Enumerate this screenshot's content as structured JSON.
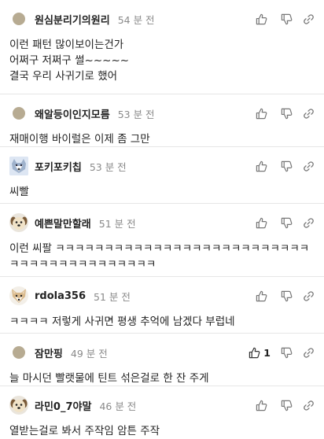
{
  "comments": [
    {
      "nickname": "원심분리기의원리",
      "time": "54 분 전",
      "text": "이런 패턴 많이보이는건가\n어쩌구 저쩌구 썰~~~~~\n결국 우리 사귀기로 했어",
      "avatar": "dot-avatar",
      "likes": ""
    },
    {
      "nickname": "왜알등이인지모름",
      "time": "53 분 전",
      "text": "재매이행 바이럴은 이제 좀 그만",
      "avatar": "dot-avatar",
      "likes": ""
    },
    {
      "nickname": "포키포키칩",
      "time": "53 분 전",
      "text": "씨빨",
      "avatar": "wolf-avatar",
      "likes": ""
    },
    {
      "nickname": "예쁜말만할래",
      "time": "51 분 전",
      "text": "이런 씨팔 ㅋㅋㅋㅋㅋㅋㅋㅋㅋㅋㅋㅋㅋㅋㅋㅋㅋㅋㅋㅋㅋㅋㅋㅋㅋㅋㅋㅋㅋㅋㅋㅋㅋㅋㅋㅋㅋㅋㅋㅋㅋ",
      "avatar": "dog-avatar",
      "likes": ""
    },
    {
      "nickname": "rdola356",
      "time": "51 분 전",
      "text": "ㅋㅋㅋㅋ 저렇게 사귀면 평생 추억에 남겠다 부럽네",
      "avatar": "fox-avatar",
      "likes": ""
    },
    {
      "nickname": "잠만핑",
      "time": "49 분 전",
      "text": "늘 마시던 빨랫물에 틴트 섞은걸로 한 잔 주게",
      "avatar": "dot-avatar",
      "likes": "1"
    },
    {
      "nickname": "라민0_7야말",
      "time": "46 분 전",
      "text": "열받는걸로 봐서 주작임 암튼 주작",
      "avatar": "dog-avatar",
      "likes": ""
    }
  ],
  "icons": {
    "like": "thumb-up-icon",
    "dislike": "thumb-down-icon",
    "link": "link-icon"
  },
  "colors": {
    "meta": "#8a8a8a",
    "divider": "#e6e6e6",
    "dot_avatar": "#b7ab92"
  }
}
